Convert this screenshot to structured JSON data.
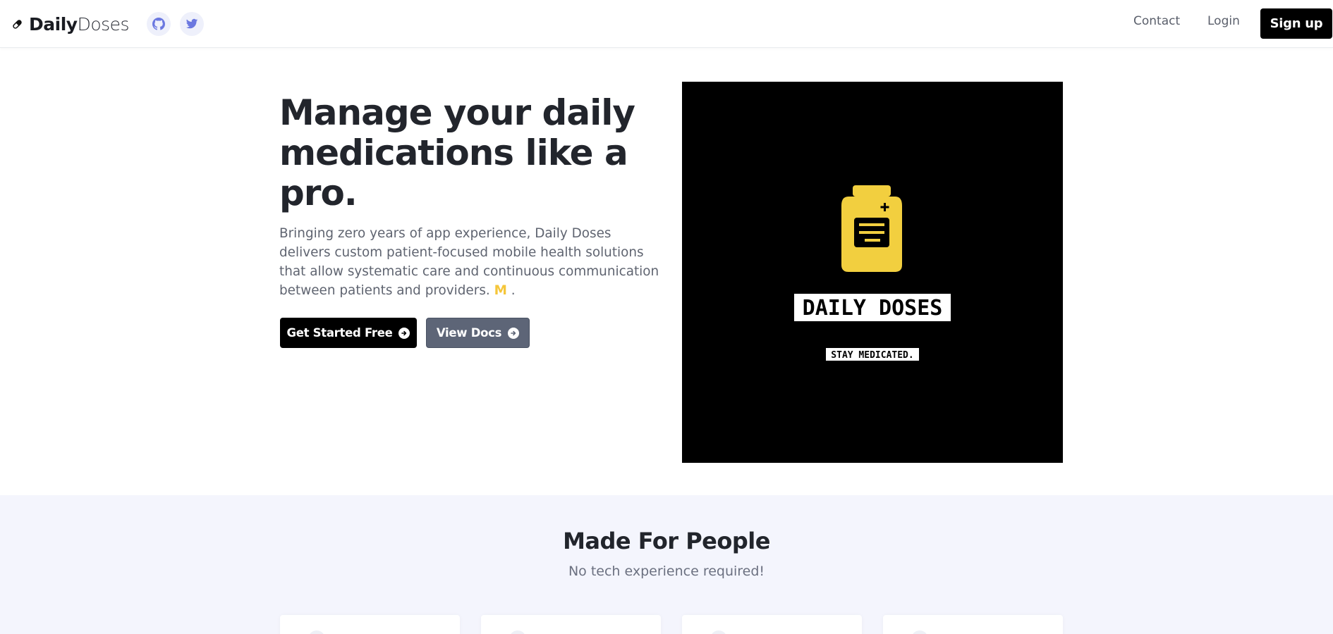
{
  "navbar": {
    "brand_bold": "Daily",
    "brand_light": "Doses",
    "links": {
      "contact": "Contact",
      "login": "Login"
    },
    "signup_label": "Sign up",
    "icons": {
      "brand": "pill-icon",
      "github": "github-icon",
      "twitter": "twitter-icon"
    }
  },
  "hero": {
    "title": "Manage your daily medications like a pro.",
    "description": "Bringing zero years of app experience, Daily Doses delivers custom patient-focused mobile health solutions that allow systematic care and continuous communication between patients and providers.",
    "accent_text": "M",
    "trailing": ".",
    "primary_button": "Get Started Free",
    "secondary_button": "View Docs",
    "image": {
      "logo_text": "DAILY DOSES",
      "tagline": "STAY MEDICATED."
    }
  },
  "features": {
    "title": "Made For People",
    "subtitle": "No tech experience required!"
  },
  "colors": {
    "accent": "#f5c63a",
    "primary": "#000000",
    "secondary": "#5d6577",
    "section_bg": "#f4f5fd",
    "icon_tint": "#6b78e0"
  }
}
